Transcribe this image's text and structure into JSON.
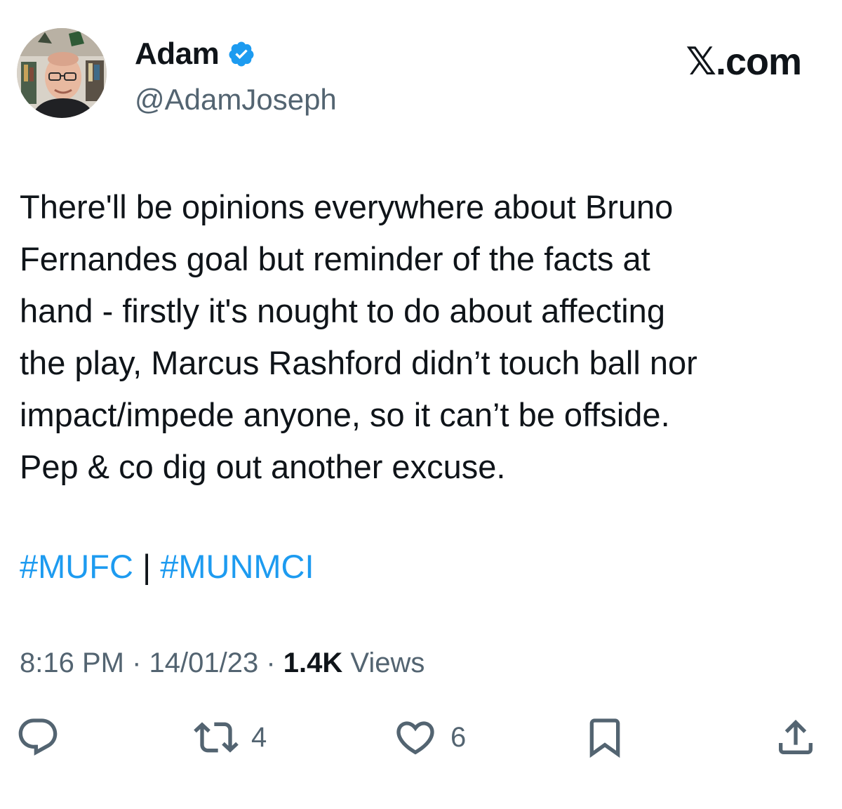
{
  "author": {
    "display_name": "Adam",
    "handle": "@AdamJoseph",
    "verified_icon": "verified-badge-icon",
    "avatar_icon": "avatar-photo"
  },
  "brand": {
    "text": ".com",
    "logo_glyph": "𝕏"
  },
  "tweet": {
    "text": "There'll be opinions everywhere about Bruno\nFernandes goal but reminder of the facts at\nhand - firstly it's nought to do about affecting\nthe play, Marcus Rashford didn’t touch ball nor\nimpact/impede anyone, so it can’t be offside.\nPep & co dig out another excuse.",
    "hashtags": [
      "#MUFC",
      "#MUNMCI"
    ],
    "hashtag_separator": " | "
  },
  "meta": {
    "time": "8:16 PM",
    "date": "14/01/23",
    "dot": " · ",
    "views_count": "1.4K",
    "views_label": " Views"
  },
  "actions": {
    "reply": {
      "icon": "reply-icon",
      "count": ""
    },
    "retweet": {
      "icon": "retweet-icon",
      "count": "4"
    },
    "like": {
      "icon": "heart-icon",
      "count": "6"
    },
    "bookmark": {
      "icon": "bookmark-icon",
      "count": ""
    },
    "share": {
      "icon": "share-icon",
      "count": ""
    }
  },
  "colors": {
    "text": "#0f1419",
    "secondary": "#536471",
    "accent": "#1d9bf0"
  }
}
